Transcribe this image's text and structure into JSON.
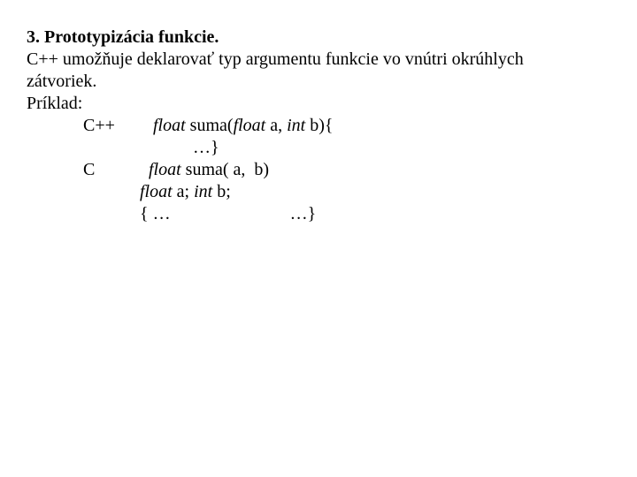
{
  "heading": "3. Prototypizácia funkcie.",
  "para1": "C++ umožňuje deklarovať typ argumentu funkcie vo vnútri okrúhlych",
  "para2": " zátvoriek.",
  "label_example": "Príklad:",
  "lang_cpp": "C++",
  "lang_c": "C",
  "cpp_line1": {
    "seg1": "   ",
    "kw1": "float",
    "seg2": " suma(",
    "kw2": "float",
    "seg3": " a, ",
    "kw3": "int",
    "seg4": " b){"
  },
  "cpp_line2": "…}",
  "c_line1": {
    "seg1": "  ",
    "kw1": "float",
    "seg2": " suma( a,  b)"
  },
  "c_line2": {
    "kw1": "float",
    "seg1": " a; ",
    "kw2": "int",
    "seg2": " b;"
  },
  "c_line3": "{ …                           …}"
}
